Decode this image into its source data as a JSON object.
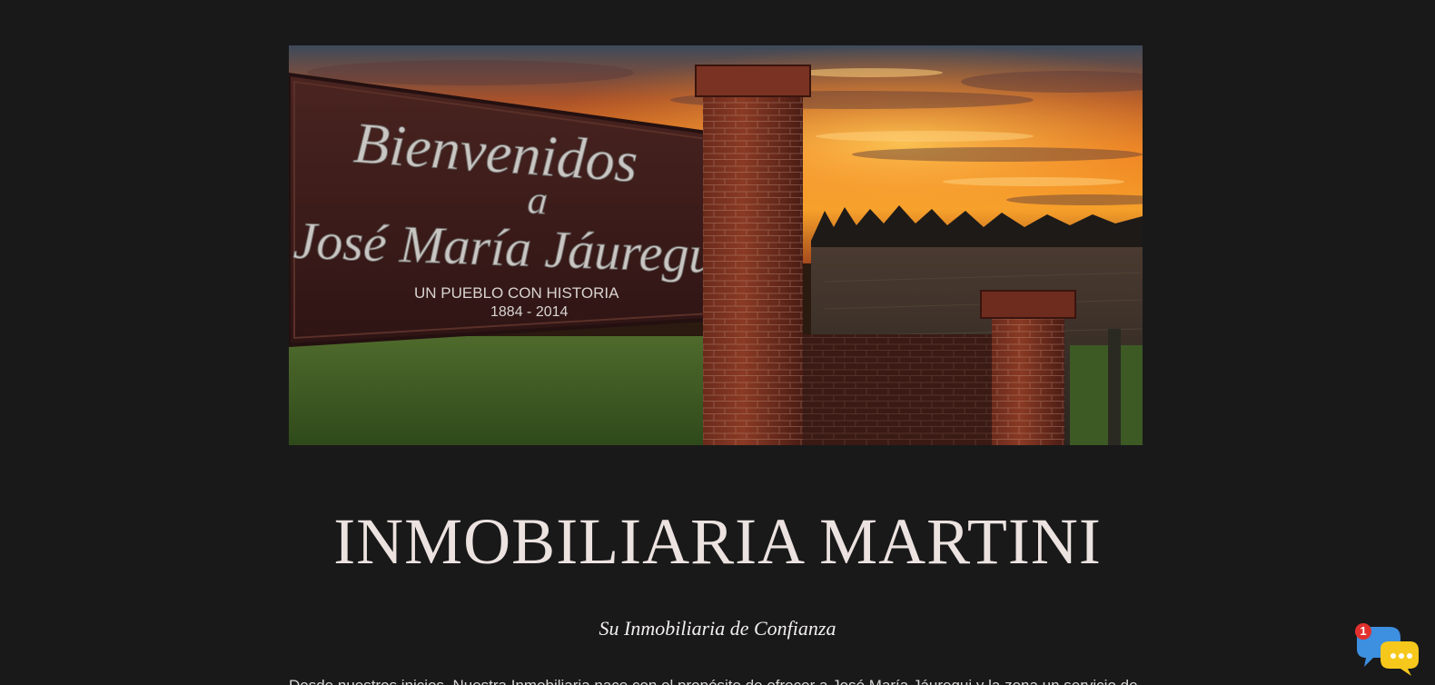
{
  "hero": {
    "sign_line1": "Bienvenidos",
    "sign_line2": "a",
    "sign_line3": "José María Jáuregui",
    "sign_line4": "UN PUEBLO CON HISTORIA",
    "sign_line5": "1884 - 2014"
  },
  "site": {
    "title": "INMOBILIARIA MARTINI",
    "tagline": "Su Inmobiliaria de Confianza",
    "intro_cut": "Desde nuestros inicios, Nuestra Inmobiliaria nace con el propósito de ofrecer a José María Jáuregui y la zona un servicio de calidad"
  },
  "chat": {
    "badge_count": "1",
    "icon": "chat-bubbles-icon"
  },
  "colors": {
    "background": "#19191a",
    "title": "#ece3e0",
    "badge": "#e2312d",
    "chat_blue": "#3d8fe0",
    "chat_yellow": "#f6c81c"
  }
}
